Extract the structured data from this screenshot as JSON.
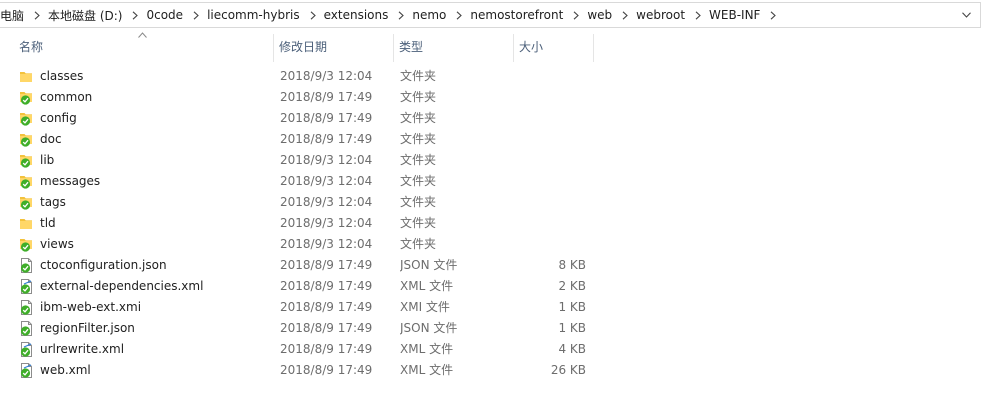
{
  "breadcrumb": [
    "电脑",
    "本地磁盘 (D:)",
    "0code",
    "liecomm-hybris",
    "extensions",
    "nemo",
    "nemostorefront",
    "web",
    "webroot",
    "WEB-INF"
  ],
  "columns": {
    "name": "名称",
    "date": "修改日期",
    "type": "类型",
    "size": "大小"
  },
  "files": [
    {
      "name": "classes",
      "date": "2018/9/3 12:04",
      "type": "文件夹",
      "size": "",
      "icon": "folder-icon"
    },
    {
      "name": "common",
      "date": "2018/8/9 17:49",
      "type": "文件夹",
      "size": "",
      "icon": "folder-synced-icon"
    },
    {
      "name": "config",
      "date": "2018/8/9 17:49",
      "type": "文件夹",
      "size": "",
      "icon": "folder-synced-icon"
    },
    {
      "name": "doc",
      "date": "2018/8/9 17:49",
      "type": "文件夹",
      "size": "",
      "icon": "folder-synced-icon"
    },
    {
      "name": "lib",
      "date": "2018/9/3 12:04",
      "type": "文件夹",
      "size": "",
      "icon": "folder-synced-icon"
    },
    {
      "name": "messages",
      "date": "2018/9/3 12:04",
      "type": "文件夹",
      "size": "",
      "icon": "folder-synced-icon"
    },
    {
      "name": "tags",
      "date": "2018/9/3 12:04",
      "type": "文件夹",
      "size": "",
      "icon": "folder-synced-icon"
    },
    {
      "name": "tld",
      "date": "2018/9/3 12:04",
      "type": "文件夹",
      "size": "",
      "icon": "folder-icon"
    },
    {
      "name": "views",
      "date": "2018/9/3 12:04",
      "type": "文件夹",
      "size": "",
      "icon": "folder-synced-icon"
    },
    {
      "name": "ctoconfiguration.json",
      "date": "2018/8/9 17:49",
      "type": "JSON 文件",
      "size": "8 KB",
      "icon": "file-synced-icon"
    },
    {
      "name": "external-dependencies.xml",
      "date": "2018/8/9 17:49",
      "type": "XML 文件",
      "size": "2 KB",
      "icon": "xml-file-synced-icon"
    },
    {
      "name": "ibm-web-ext.xmi",
      "date": "2018/8/9 17:49",
      "type": "XMI 文件",
      "size": "1 KB",
      "icon": "file-synced-icon"
    },
    {
      "name": "regionFilter.json",
      "date": "2018/8/9 17:49",
      "type": "JSON 文件",
      "size": "1 KB",
      "icon": "file-synced-icon"
    },
    {
      "name": "urlrewrite.xml",
      "date": "2018/8/9 17:49",
      "type": "XML 文件",
      "size": "4 KB",
      "icon": "xml-file-synced-icon"
    },
    {
      "name": "web.xml",
      "date": "2018/8/9 17:49",
      "type": "XML 文件",
      "size": "26 KB",
      "icon": "xml-file-synced-icon"
    }
  ],
  "colors": {
    "folder": "#f3c23c",
    "sync_badge": "#3fae29",
    "header_text": "#4c607a",
    "meta_text": "#6d6d6d"
  }
}
